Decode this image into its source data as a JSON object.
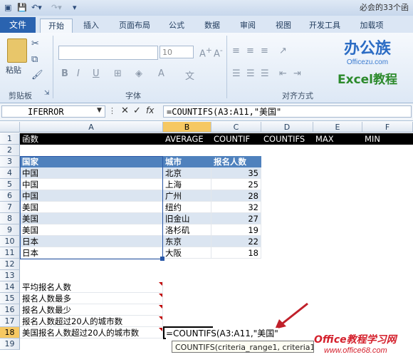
{
  "titlebar": {
    "title": "必会的33个函"
  },
  "tabs": [
    {
      "label": "文件"
    },
    {
      "label": "开始"
    },
    {
      "label": "插入"
    },
    {
      "label": "页面布局"
    },
    {
      "label": "公式"
    },
    {
      "label": "数据"
    },
    {
      "label": "审阅"
    },
    {
      "label": "视图"
    },
    {
      "label": "开发工具"
    },
    {
      "label": "加载项"
    }
  ],
  "ribbon": {
    "paste_label": "粘贴",
    "font_size": "10",
    "groups": {
      "clipboard": "剪贴板",
      "font": "字体",
      "alignment": "对齐方式"
    },
    "bold": "B",
    "italic": "I",
    "underline": "U"
  },
  "logo": {
    "line1": "办公族",
    "line2": "Officezu.com",
    "line3": "Excel教程"
  },
  "formula_bar": {
    "name_box": "IFERROR",
    "fx": "fx",
    "formula": "=COUNTIFS(A3:A11,\"美国\""
  },
  "columns": [
    "A",
    "B",
    "C",
    "D",
    "E",
    "F"
  ],
  "rows": [
    "1",
    "2",
    "3",
    "4",
    "5",
    "6",
    "7",
    "8",
    "9",
    "10",
    "11",
    "12",
    "13",
    "14",
    "15",
    "16",
    "17",
    "18",
    "19"
  ],
  "sheet": {
    "row1": {
      "a": "函数",
      "b": "AVERAGE",
      "c": "COUNTIF",
      "d": "COUNTIFS",
      "e": "MAX",
      "f": "MIN"
    },
    "table_header": {
      "country": "国家",
      "city": "城市",
      "count": "报名人数"
    },
    "table_rows": [
      {
        "country": "中国",
        "city": "北京",
        "count": "35"
      },
      {
        "country": "中国",
        "city": "上海",
        "count": "25"
      },
      {
        "country": "中国",
        "city": "广州",
        "count": "28"
      },
      {
        "country": "美国",
        "city": "纽约",
        "count": "32"
      },
      {
        "country": "美国",
        "city": "旧金山",
        "count": "27"
      },
      {
        "country": "美国",
        "city": "洛杉矶",
        "count": "19"
      },
      {
        "country": "日本",
        "city": "东京",
        "count": "22"
      },
      {
        "country": "日本",
        "city": "大阪",
        "count": "18"
      }
    ],
    "labels": {
      "r14": "平均报名人数",
      "r15": "报名人数最多",
      "r16": "报名人数最少",
      "r17": "报名人数超过20人的城市数",
      "r18": "美国报名人数超过20人的城市数"
    },
    "active_cell_text": "=COUNTIFS(A3:A11,\"美国\""
  },
  "tooltip": {
    "text": "COUNTIFS(criteria_range1, criteria1, ..."
  },
  "watermark": {
    "line1": "Office教程学习网",
    "line2": "www.office68.com"
  }
}
